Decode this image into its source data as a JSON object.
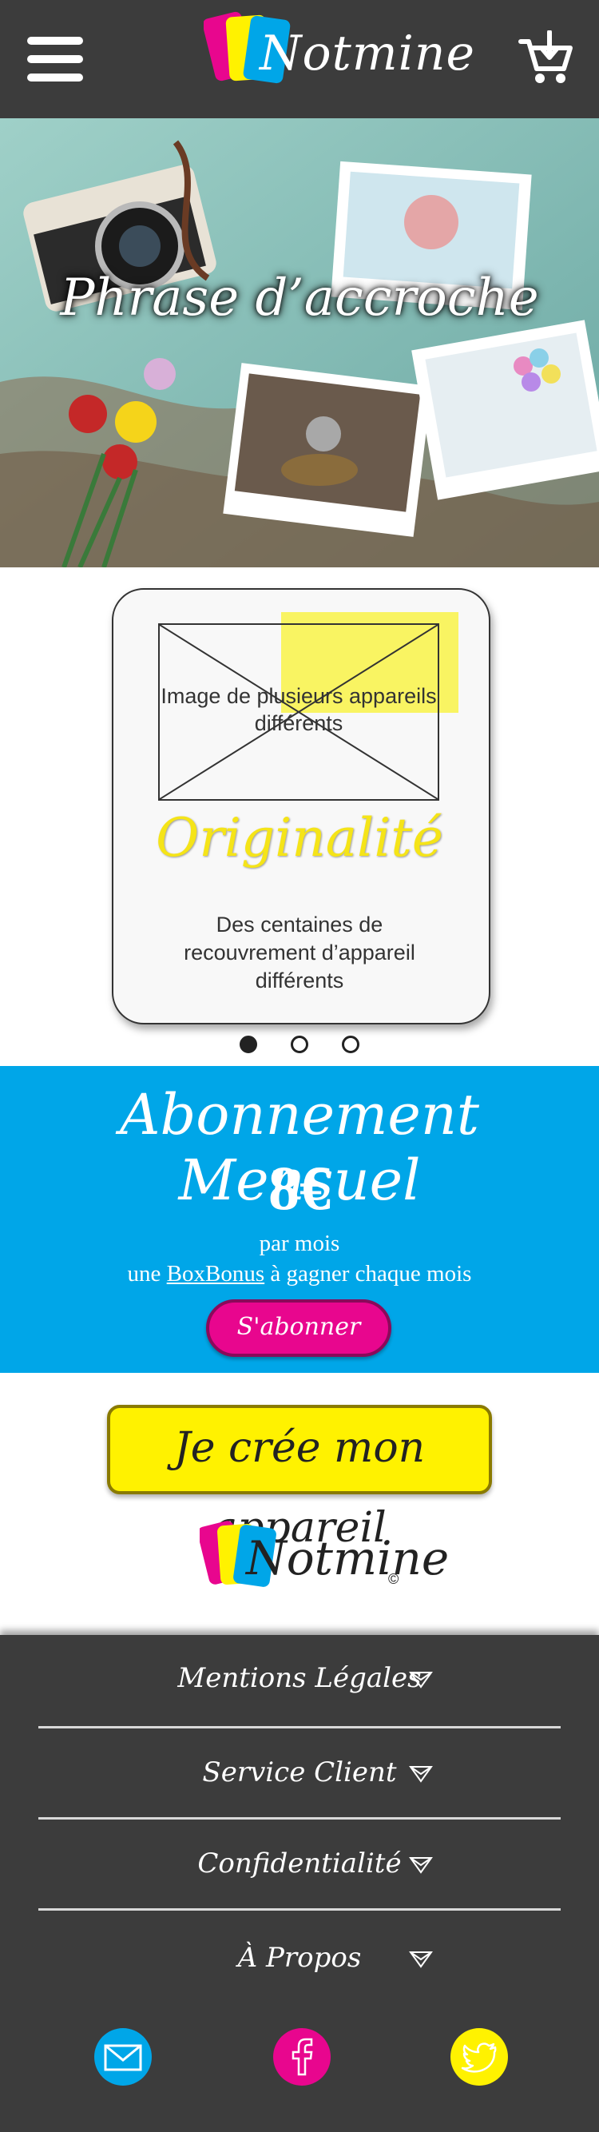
{
  "header": {
    "logo_text": "Notmine",
    "menu_icon": "hamburger-icon",
    "cart_icon": "cart-add-icon"
  },
  "hero": {
    "tagline": "Phrase d’accroche",
    "image": "vintage-camera-photos-image"
  },
  "carousel": {
    "image_placeholder_text": "Image de plusieurs appareils différents",
    "title": "Originalité",
    "description": "Des centaines de recouvrement d’appareil différents",
    "dots": 3,
    "active_dot": 0
  },
  "subscription": {
    "title": "Abonnement Mensuel",
    "price": "8€",
    "per": "par mois",
    "line_prefix": "une ",
    "line_link": "BoxBonus",
    "line_suffix": " à gagner chaque mois",
    "button": "S'abonner"
  },
  "create_button": "Je crée mon appareil",
  "logo2": {
    "text": "Notmine",
    "copyright": "©"
  },
  "footer": {
    "items": [
      {
        "label": "Mentions Légales"
      },
      {
        "label": "Service Client"
      },
      {
        "label": "Confidentialité"
      },
      {
        "label": "À Propos"
      }
    ],
    "social": [
      {
        "icon": "mail-icon",
        "color": "#00a6e8"
      },
      {
        "icon": "facebook-icon",
        "color": "#e8068e"
      },
      {
        "icon": "twitter-icon",
        "color": "#fff200"
      }
    ]
  },
  "colors": {
    "header_bg": "#3c3c3c",
    "cyan": "#00a6e8",
    "magenta": "#e8068e",
    "yellow": "#fff200"
  }
}
